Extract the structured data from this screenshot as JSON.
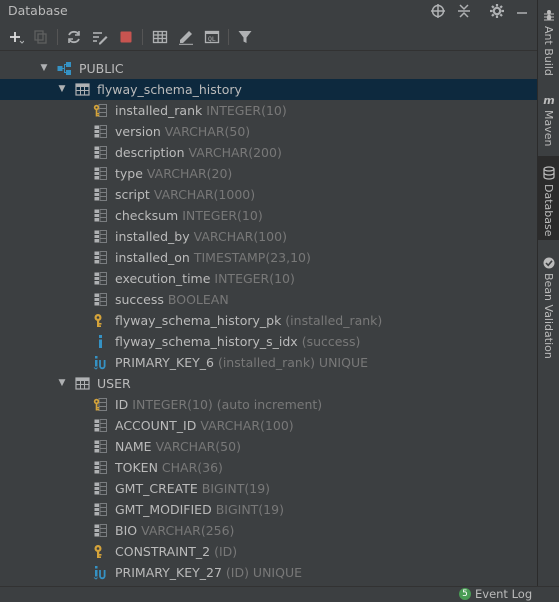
{
  "window": {
    "title": "Database"
  },
  "schema": {
    "label": "PUBLIC"
  },
  "tables": [
    {
      "name": "flyway_schema_history",
      "items": [
        {
          "name": "installed_rank",
          "detail": "INTEGER(10)",
          "icon": "pk-column-icon"
        },
        {
          "name": "version",
          "detail": "VARCHAR(50)",
          "icon": "column-icon"
        },
        {
          "name": "description",
          "detail": "VARCHAR(200)",
          "icon": "column-icon"
        },
        {
          "name": "type",
          "detail": "VARCHAR(20)",
          "icon": "column-icon"
        },
        {
          "name": "script",
          "detail": "VARCHAR(1000)",
          "icon": "column-icon"
        },
        {
          "name": "checksum",
          "detail": "INTEGER(10)",
          "icon": "column-icon"
        },
        {
          "name": "installed_by",
          "detail": "VARCHAR(100)",
          "icon": "column-icon"
        },
        {
          "name": "installed_on",
          "detail": "TIMESTAMP(23,10)",
          "icon": "column-icon"
        },
        {
          "name": "execution_time",
          "detail": "INTEGER(10)",
          "icon": "column-icon"
        },
        {
          "name": "success",
          "detail": "BOOLEAN",
          "icon": "column-icon"
        },
        {
          "name": "flyway_schema_history_pk",
          "detail": "(installed_rank)",
          "icon": "key-icon"
        },
        {
          "name": "flyway_schema_history_s_idx",
          "detail": "(success)",
          "icon": "index-icon"
        },
        {
          "name": "PRIMARY_KEY_6",
          "detail": "(installed_rank) UNIQUE",
          "icon": "unique-index-icon"
        }
      ]
    },
    {
      "name": "USER",
      "items": [
        {
          "name": "ID",
          "detail": "INTEGER(10) (auto increment)",
          "icon": "pk-column-icon"
        },
        {
          "name": "ACCOUNT_ID",
          "detail": "VARCHAR(100)",
          "icon": "column-icon"
        },
        {
          "name": "NAME",
          "detail": "VARCHAR(50)",
          "icon": "column-icon"
        },
        {
          "name": "TOKEN",
          "detail": "CHAR(36)",
          "icon": "column-icon"
        },
        {
          "name": "GMT_CREATE",
          "detail": "BIGINT(19)",
          "icon": "column-icon"
        },
        {
          "name": "GMT_MODIFIED",
          "detail": "BIGINT(19)",
          "icon": "column-icon"
        },
        {
          "name": "BIO",
          "detail": "VARCHAR(256)",
          "icon": "column-icon"
        },
        {
          "name": "CONSTRAINT_2",
          "detail": "(ID)",
          "icon": "key-icon"
        },
        {
          "name": "PRIMARY_KEY_27",
          "detail": "(ID) UNIQUE",
          "icon": "unique-index-icon"
        }
      ]
    }
  ],
  "sidebar": {
    "tabs": [
      {
        "label": "Ant Build",
        "icon": "ant-icon"
      },
      {
        "label": "Maven",
        "icon": "maven-icon"
      },
      {
        "label": "Database",
        "icon": "database-icon"
      },
      {
        "label": "Bean Validation",
        "icon": "bean-validation-icon"
      }
    ]
  },
  "status": {
    "event_count": "5",
    "event_log_label": "Event Log"
  },
  "colors": {
    "background": "#3c3f41",
    "selection": "#0d293e",
    "text": "#bbbbbb",
    "type_text": "#787878",
    "key_gold": "#d4a33a",
    "index_blue": "#3592c4",
    "stop_red": "#c75450"
  }
}
